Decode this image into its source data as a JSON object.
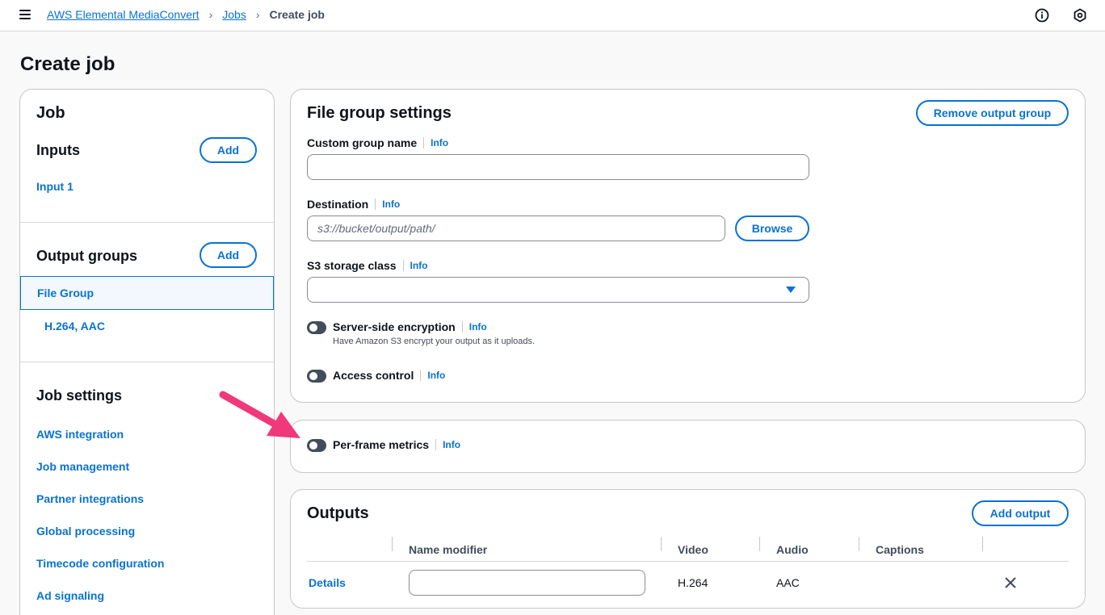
{
  "breadcrumb": {
    "service": "AWS Elemental MediaConvert",
    "jobs": "Jobs",
    "current": "Create job"
  },
  "page": {
    "title": "Create job"
  },
  "nav": {
    "job_heading": "Job",
    "inputs_heading": "Inputs",
    "inputs_add": "Add",
    "input_item": "Input 1",
    "output_groups_heading": "Output groups",
    "output_groups_add": "Add",
    "file_group": "File Group",
    "file_group_child": "H.264, AAC",
    "job_settings_heading": "Job settings",
    "job_settings_items": [
      "AWS integration",
      "Job management",
      "Partner integrations",
      "Global processing",
      "Timecode configuration",
      "Ad signaling"
    ]
  },
  "file_group_settings": {
    "title": "File group settings",
    "remove_button": "Remove output group",
    "custom_group_name_label": "Custom group name",
    "custom_group_name_value": "",
    "destination_label": "Destination",
    "destination_placeholder": "s3://bucket/output/path/",
    "browse_button": "Browse",
    "storage_class_label": "S3 storage class",
    "storage_class_value": "",
    "sse_label": "Server-side encryption",
    "sse_desc": "Have Amazon S3 encrypt your output as it uploads.",
    "access_control_label": "Access control",
    "info": "Info"
  },
  "per_frame": {
    "label": "Per-frame metrics",
    "info": "Info"
  },
  "outputs": {
    "title": "Outputs",
    "add_button": "Add output",
    "columns": [
      "Name modifier",
      "Video",
      "Audio",
      "Captions"
    ],
    "row": {
      "details": "Details",
      "name_modifier": "",
      "video": "H.264",
      "audio": "AAC",
      "captions": ""
    }
  },
  "colors": {
    "accent": "#0972d3",
    "annotation_arrow": "#f0397a"
  }
}
